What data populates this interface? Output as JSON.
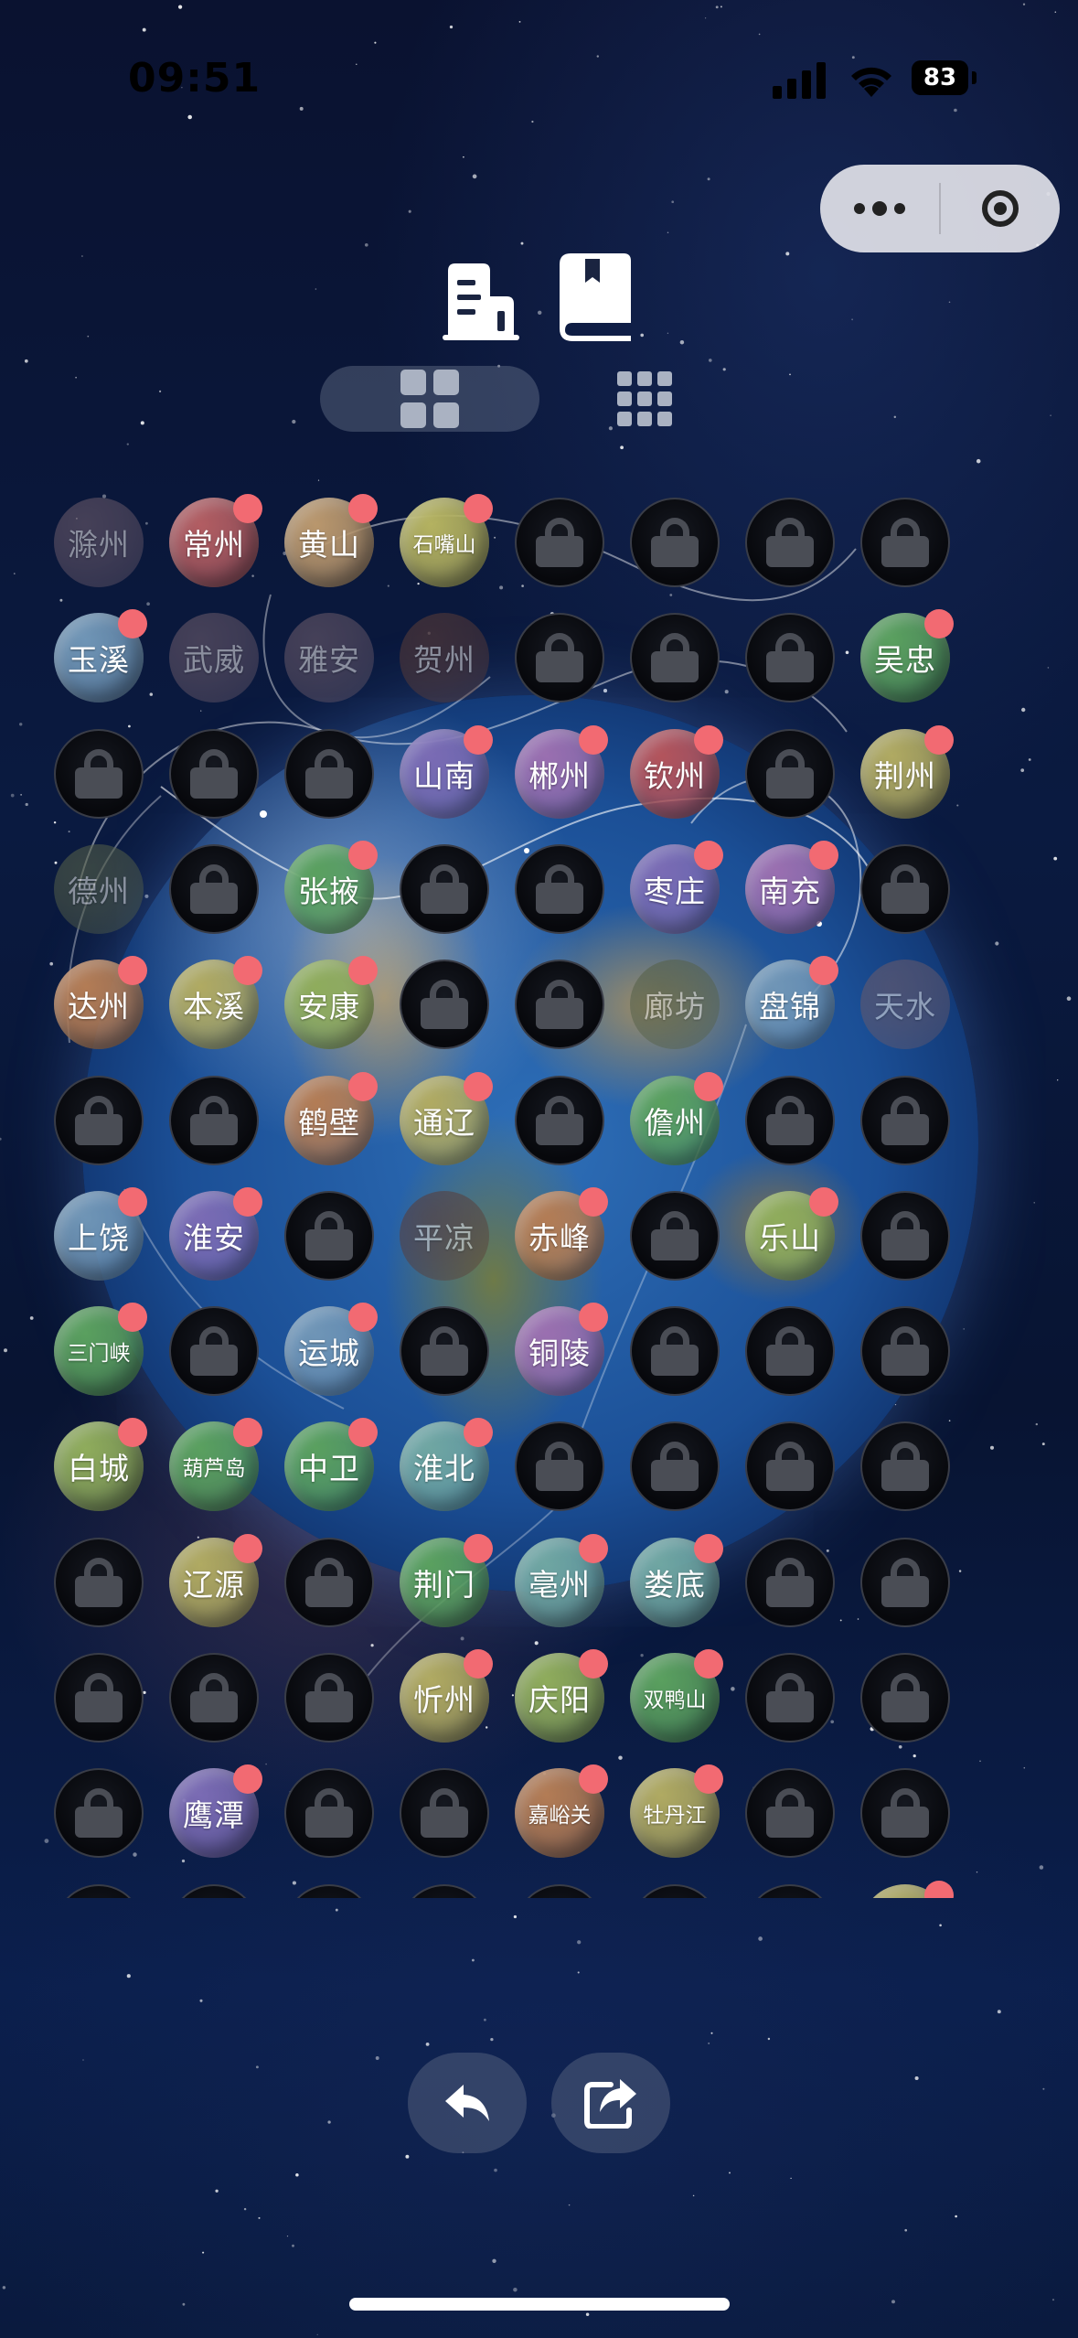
{
  "status_bar": {
    "time": "09:51",
    "battery": "83"
  },
  "colors": {
    "badge": "#f26a72",
    "palette": {
      "rose": "#b25d62",
      "sand": "#b9976d",
      "olive": "#b4b260",
      "steel": "#6f95b6",
      "violet": "#7a6bb4",
      "orchid": "#9a6fb0",
      "crimson": "#b3545c",
      "green": "#5aa05f",
      "khaki": "#b0aa62",
      "leaf": "#8fac5c",
      "copper": "#b37c55",
      "teal": "#6fa6a2",
      "plum": "#8b6088",
      "slate": "#5a6d9a",
      "brown": "#5a3c38",
      "moss": "#556048",
      "mauve": "#6a5a6a",
      "grayblue": "#4f5c74"
    }
  },
  "grid": [
    [
      {
        "name": "滁州",
        "state": "dim",
        "color": "mauve",
        "badge": false
      },
      {
        "name": "常州",
        "state": "unlocked",
        "color": "rose",
        "badge": true
      },
      {
        "name": "黄山",
        "state": "unlocked",
        "color": "sand",
        "badge": true
      },
      {
        "name": "石嘴山",
        "state": "unlocked",
        "color": "olive",
        "badge": true,
        "small": true
      },
      {
        "name": "",
        "state": "locked"
      },
      {
        "name": "",
        "state": "locked"
      },
      {
        "name": "",
        "state": "locked"
      },
      {
        "name": "",
        "state": "locked"
      }
    ],
    [
      {
        "name": "玉溪",
        "state": "unlocked",
        "color": "steel",
        "badge": true
      },
      {
        "name": "武威",
        "state": "dim",
        "color": "mauve",
        "badge": false
      },
      {
        "name": "雅安",
        "state": "dim",
        "color": "mauve",
        "badge": false
      },
      {
        "name": "贺州",
        "state": "dim",
        "color": "brown",
        "badge": false
      },
      {
        "name": "",
        "state": "locked"
      },
      {
        "name": "",
        "state": "locked"
      },
      {
        "name": "",
        "state": "locked"
      },
      {
        "name": "吴忠",
        "state": "unlocked",
        "color": "green",
        "badge": true
      }
    ],
    [
      {
        "name": "",
        "state": "locked"
      },
      {
        "name": "",
        "state": "locked"
      },
      {
        "name": "",
        "state": "locked"
      },
      {
        "name": "山南",
        "state": "unlocked",
        "color": "violet",
        "badge": true
      },
      {
        "name": "郴州",
        "state": "unlocked",
        "color": "orchid",
        "badge": true
      },
      {
        "name": "钦州",
        "state": "unlocked",
        "color": "crimson",
        "badge": true
      },
      {
        "name": "",
        "state": "locked"
      },
      {
        "name": "荆州",
        "state": "unlocked",
        "color": "khaki",
        "badge": true
      }
    ],
    [
      {
        "name": "德州",
        "state": "dim",
        "color": "moss",
        "badge": false
      },
      {
        "name": "",
        "state": "locked"
      },
      {
        "name": "张掖",
        "state": "unlocked",
        "color": "green",
        "badge": true
      },
      {
        "name": "",
        "state": "locked"
      },
      {
        "name": "",
        "state": "locked"
      },
      {
        "name": "枣庄",
        "state": "unlocked",
        "color": "violet",
        "badge": true
      },
      {
        "name": "南充",
        "state": "unlocked",
        "color": "orchid",
        "badge": true
      },
      {
        "name": "",
        "state": "locked"
      }
    ],
    [
      {
        "name": "达州",
        "state": "unlocked",
        "color": "copper",
        "badge": true
      },
      {
        "name": "本溪",
        "state": "unlocked",
        "color": "khaki",
        "badge": true
      },
      {
        "name": "安康",
        "state": "unlocked",
        "color": "leaf",
        "badge": true
      },
      {
        "name": "",
        "state": "locked"
      },
      {
        "name": "",
        "state": "locked"
      },
      {
        "name": "廊坊",
        "state": "dim",
        "color": "moss",
        "badge": false
      },
      {
        "name": "盘锦",
        "state": "unlocked",
        "color": "steel",
        "badge": true
      },
      {
        "name": "天水",
        "state": "dim",
        "color": "mauve",
        "badge": false
      }
    ],
    [
      {
        "name": "",
        "state": "locked"
      },
      {
        "name": "",
        "state": "locked"
      },
      {
        "name": "鹤壁",
        "state": "unlocked",
        "color": "copper",
        "badge": true
      },
      {
        "name": "通辽",
        "state": "unlocked",
        "color": "khaki",
        "badge": true
      },
      {
        "name": "",
        "state": "locked"
      },
      {
        "name": "儋州",
        "state": "unlocked",
        "color": "green",
        "badge": true
      },
      {
        "name": "",
        "state": "locked"
      },
      {
        "name": "",
        "state": "locked"
      }
    ],
    [
      {
        "name": "上饶",
        "state": "unlocked",
        "color": "steel",
        "badge": true
      },
      {
        "name": "淮安",
        "state": "unlocked",
        "color": "violet",
        "badge": true
      },
      {
        "name": "",
        "state": "locked"
      },
      {
        "name": "平凉",
        "state": "dim",
        "color": "brown",
        "badge": false
      },
      {
        "name": "赤峰",
        "state": "unlocked",
        "color": "copper",
        "badge": true
      },
      {
        "name": "",
        "state": "locked"
      },
      {
        "name": "乐山",
        "state": "unlocked",
        "color": "leaf",
        "badge": true
      },
      {
        "name": "",
        "state": "locked"
      }
    ],
    [
      {
        "name": "三门峡",
        "state": "unlocked",
        "color": "green",
        "badge": true,
        "small": true
      },
      {
        "name": "",
        "state": "locked"
      },
      {
        "name": "运城",
        "state": "unlocked",
        "color": "steel",
        "badge": true
      },
      {
        "name": "",
        "state": "locked"
      },
      {
        "name": "铜陵",
        "state": "unlocked",
        "color": "orchid",
        "badge": true
      },
      {
        "name": "",
        "state": "locked"
      },
      {
        "name": "",
        "state": "locked"
      },
      {
        "name": "",
        "state": "locked"
      }
    ],
    [
      {
        "name": "白城",
        "state": "unlocked",
        "color": "leaf",
        "badge": true
      },
      {
        "name": "葫芦岛",
        "state": "unlocked",
        "color": "green",
        "badge": true,
        "small": true
      },
      {
        "name": "中卫",
        "state": "unlocked",
        "color": "green",
        "badge": true
      },
      {
        "name": "淮北",
        "state": "unlocked",
        "color": "teal",
        "badge": true
      },
      {
        "name": "",
        "state": "locked"
      },
      {
        "name": "",
        "state": "locked"
      },
      {
        "name": "",
        "state": "locked"
      },
      {
        "name": "",
        "state": "locked"
      }
    ],
    [
      {
        "name": "",
        "state": "locked"
      },
      {
        "name": "辽源",
        "state": "unlocked",
        "color": "khaki",
        "badge": true
      },
      {
        "name": "",
        "state": "locked"
      },
      {
        "name": "荆门",
        "state": "unlocked",
        "color": "green",
        "badge": true
      },
      {
        "name": "亳州",
        "state": "unlocked",
        "color": "teal",
        "badge": true
      },
      {
        "name": "娄底",
        "state": "unlocked",
        "color": "teal",
        "badge": true
      },
      {
        "name": "",
        "state": "locked"
      },
      {
        "name": "",
        "state": "locked"
      }
    ],
    [
      {
        "name": "",
        "state": "locked"
      },
      {
        "name": "",
        "state": "locked"
      },
      {
        "name": "",
        "state": "locked"
      },
      {
        "name": "忻州",
        "state": "unlocked",
        "color": "khaki",
        "badge": true
      },
      {
        "name": "庆阳",
        "state": "unlocked",
        "color": "leaf",
        "badge": true
      },
      {
        "name": "双鸭山",
        "state": "unlocked",
        "color": "green",
        "badge": true,
        "small": true
      },
      {
        "name": "",
        "state": "locked"
      },
      {
        "name": "",
        "state": "locked"
      }
    ],
    [
      {
        "name": "",
        "state": "locked"
      },
      {
        "name": "鹰潭",
        "state": "unlocked",
        "color": "violet",
        "badge": true
      },
      {
        "name": "",
        "state": "locked"
      },
      {
        "name": "",
        "state": "locked"
      },
      {
        "name": "嘉峪关",
        "state": "unlocked",
        "color": "copper",
        "badge": true,
        "small": true
      },
      {
        "name": "牡丹江",
        "state": "unlocked",
        "color": "khaki",
        "badge": true,
        "small": true
      },
      {
        "name": "",
        "state": "locked"
      },
      {
        "name": "",
        "state": "locked"
      }
    ],
    [
      {
        "name": "",
        "state": "locked"
      },
      {
        "name": "",
        "state": "locked"
      },
      {
        "name": "",
        "state": "locked"
      },
      {
        "name": "",
        "state": "locked"
      },
      {
        "name": "",
        "state": "locked"
      },
      {
        "name": "",
        "state": "locked"
      },
      {
        "name": "",
        "state": "locked"
      },
      {
        "name": "",
        "state": "unlocked",
        "color": "khaki",
        "badge": true
      }
    ]
  ]
}
